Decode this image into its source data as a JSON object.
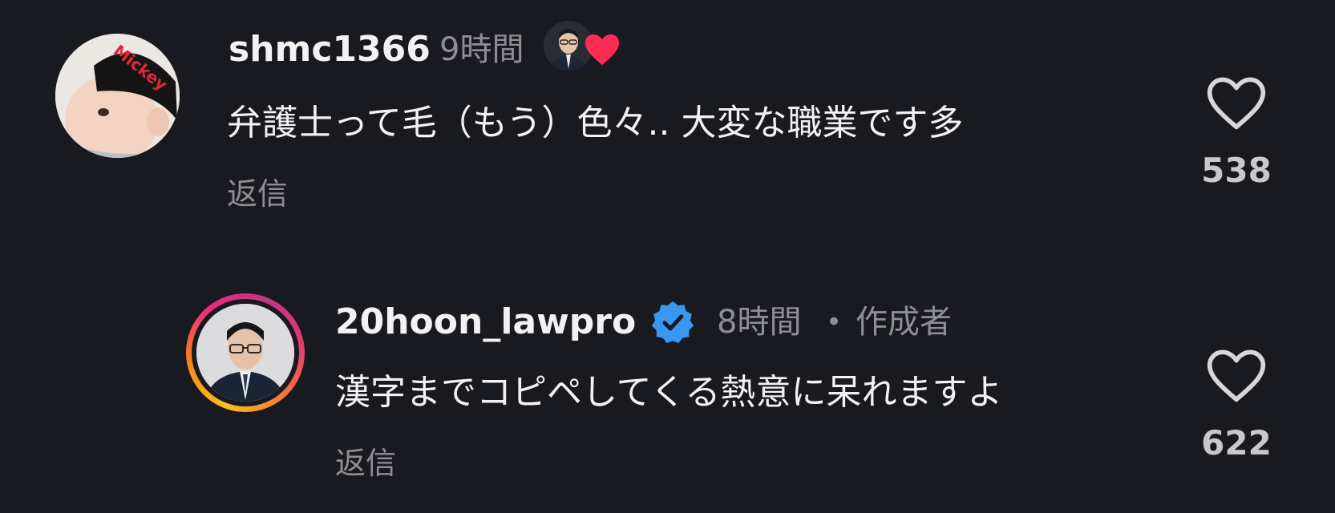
{
  "comments": [
    {
      "username": "shmc1366",
      "time": "9時間",
      "text": "弁護士って毛（もう）色々.. 大変な職業です多",
      "reply_label": "返信",
      "likes": "538",
      "avatar_text": "Mickey",
      "liked_by_creator": true
    },
    {
      "username": "20hoon_lawpro",
      "verified": true,
      "time": "8時間",
      "author_label": "作成者",
      "separator": "•",
      "text": "漢字までコピペしてくる熱意に呆れますよ",
      "reply_label": "返信",
      "likes": "622"
    }
  ],
  "colors": {
    "background": "#191a1f",
    "text_primary": "#f2f2f2",
    "text_secondary": "#8e8f95",
    "like_heart": "#fe2c55",
    "verified_blue": "#3897f0"
  },
  "icons": [
    "heart-outline-icon",
    "heart-filled-icon",
    "verified-badge-icon"
  ]
}
